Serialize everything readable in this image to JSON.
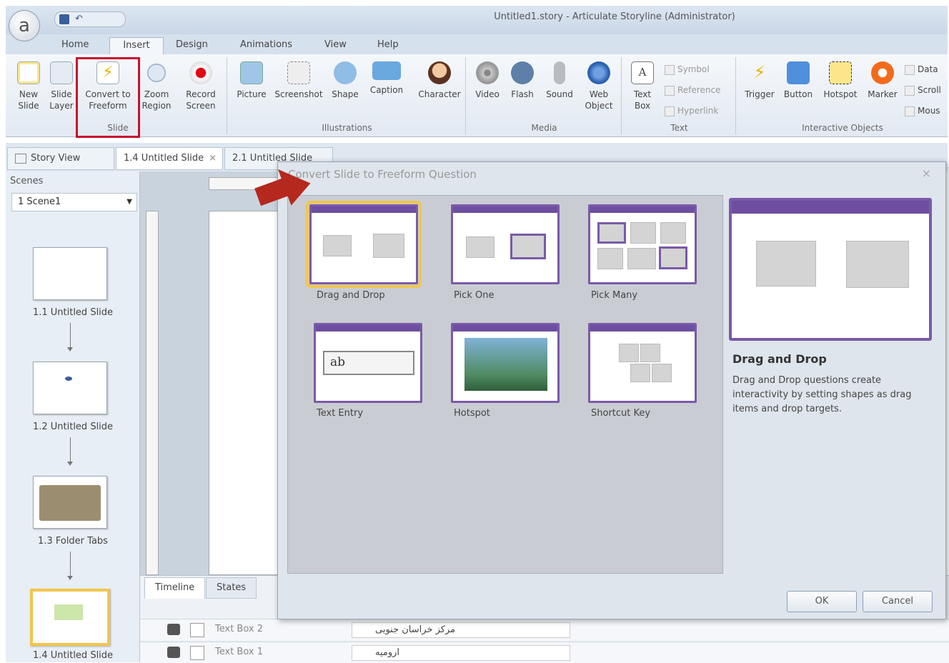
{
  "window": {
    "title": "Untitled1.story - Articulate Storyline (Administrator)",
    "logo_letter": "a"
  },
  "ribbon_tabs": [
    "Home",
    "Insert",
    "Design",
    "Animations",
    "View",
    "Help"
  ],
  "ribbon": {
    "slide_group": {
      "caption": "Slide",
      "buttons": [
        "New Slide",
        "Slide Layer",
        "Convert to Freeform"
      ]
    },
    "zoom_record": {
      "zoom": "Zoom Region",
      "record": "Record Screen"
    },
    "illustrations": {
      "caption": "Illustrations",
      "buttons": [
        "Picture",
        "Screenshot",
        "Shape",
        "Caption",
        "Character"
      ]
    },
    "media": {
      "caption": "Media",
      "buttons": [
        "Video",
        "Flash",
        "Sound",
        "Web Object"
      ]
    },
    "text": {
      "caption": "Text",
      "text_box": "Text Box",
      "small": [
        "Symbol",
        "Reference",
        "Hyperlink"
      ]
    },
    "interactive": {
      "caption": "Interactive Objects",
      "buttons": [
        "Trigger",
        "Button",
        "Hotspot",
        "Marker"
      ],
      "small": [
        "Data",
        "Scroll",
        "Mous"
      ]
    }
  },
  "doc_tabs": {
    "story_view": "Story View",
    "tab1": "1.4 Untitled Slide",
    "tab1_close": "×",
    "tab2": "2.1 Untitled Slide"
  },
  "scenes": {
    "header": "Scenes",
    "selected": "1 Scene1",
    "slides": [
      "1.1 Untitled Slide",
      "1.2 Untitled Slide",
      "1.3 Folder Tabs",
      "1.4 Untitled Slide"
    ]
  },
  "bottom": {
    "tabs": [
      "Timeline",
      "States"
    ],
    "rows": [
      {
        "name": "Text Box 2",
        "content": "مرکز خراسان جنوبی"
      },
      {
        "name": "Text Box 1",
        "content": "ارومیه"
      }
    ]
  },
  "dialog": {
    "title": "Convert Slide to Freeform Question",
    "close": "×",
    "options": [
      "Drag and Drop",
      "Pick One",
      "Pick Many",
      "Text Entry",
      "Hotspot",
      "Shortcut Key"
    ],
    "text_entry_sample": "ab",
    "selected": "Drag and Drop",
    "preview_title": "Drag and Drop",
    "preview_desc": "Drag and Drop questions create interactivity by setting shapes as drag items and drop targets.",
    "ok": "OK",
    "cancel": "Cancel"
  },
  "colors": {
    "highlight": "#c8102e",
    "purple": "#6e4ea0",
    "selection": "#f2c64d"
  }
}
